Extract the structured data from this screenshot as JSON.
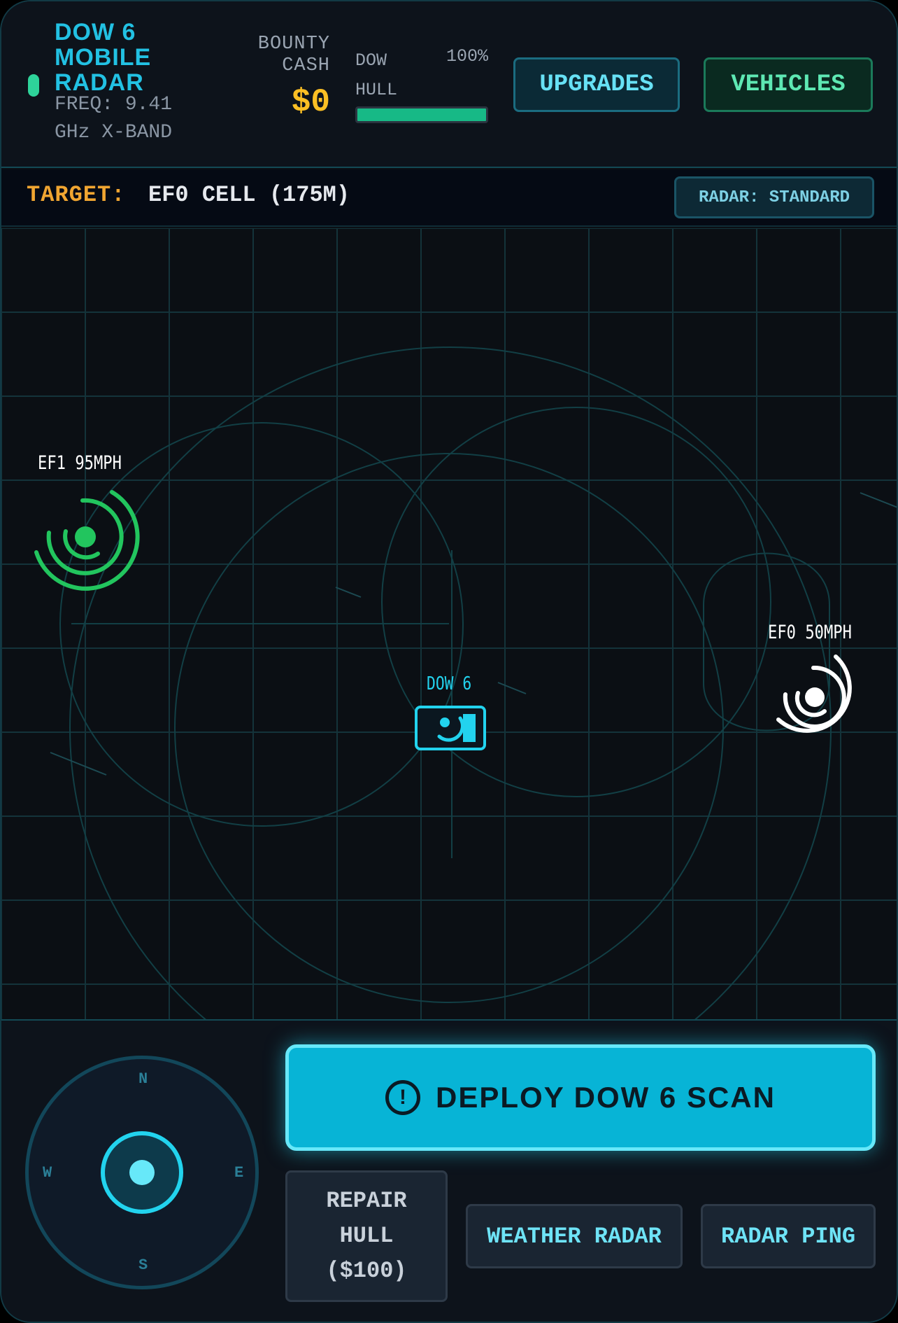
{
  "header": {
    "title": "DOW 6 MOBILE RADAR",
    "frequency": "FREQ: 9.41 GHz X-BAND",
    "bounty_label": "BOUNTY CASH",
    "bounty_value": "$0",
    "hull_label": "DOW HULL",
    "hull_percent": "100%",
    "hull_level": 1.0,
    "upgrades_label": "UPGRADES",
    "vehicles_label": "VEHICLES"
  },
  "target_bar": {
    "label": "TARGET:",
    "value": "EF0 CELL (175M)",
    "radar_mode": "RADAR: STANDARD"
  },
  "map": {
    "storms": [
      {
        "label": "EF1 95MPH",
        "color": "#22c55e"
      },
      {
        "label": "EF0 50MPH",
        "color": "#ffffff"
      }
    ],
    "player_label": "DOW 6",
    "player_color": "#22d3ee",
    "grid_color": "#14333a"
  },
  "controls": {
    "joystick": {
      "n": "N",
      "s": "S",
      "w": "W",
      "e": "E"
    },
    "deploy_icon": "!",
    "deploy_label": "DEPLOY DOW 6 SCAN",
    "repair_label": "REPAIR HULL ($100)",
    "weather_label": "WEATHER RADAR",
    "ping_label": "RADAR PING"
  }
}
